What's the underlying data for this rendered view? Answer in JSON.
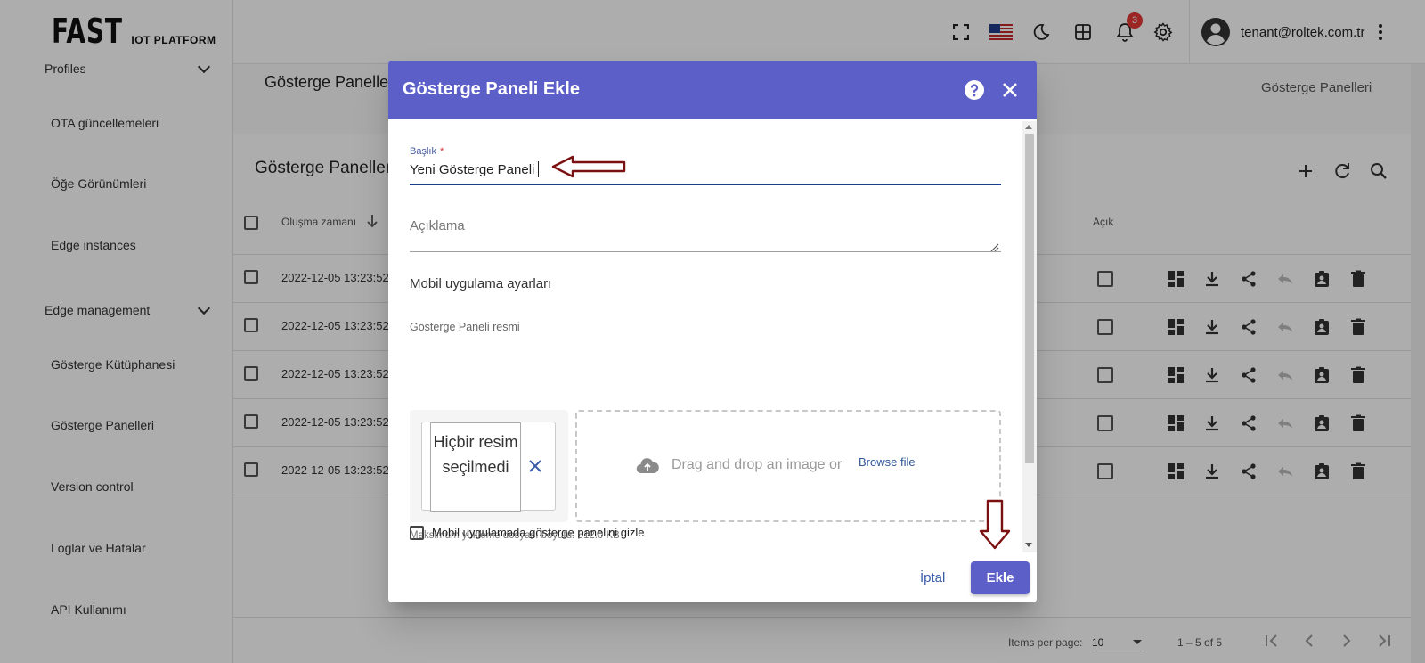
{
  "app": {
    "logo_main": "FAST",
    "logo_sub": "IOT PLATFORM",
    "user_email": "tenant@roltek.com.tr",
    "notification_count": "3"
  },
  "sidebar": {
    "items": [
      {
        "label": "Profiles",
        "type": "group"
      },
      {
        "label": "OTA güncellemeleri"
      },
      {
        "label": "Öğe Görünümleri"
      },
      {
        "label": "Edge instances"
      },
      {
        "label": "Edge management",
        "type": "group"
      },
      {
        "label": "Gösterge Kütüphanesi"
      },
      {
        "label": "Gösterge Panelleri"
      },
      {
        "label": "Version control"
      },
      {
        "label": "Loglar ve Hatalar"
      },
      {
        "label": "API Kullanımı"
      }
    ]
  },
  "page": {
    "breadcrumb_title": "Gösterge Panelleri",
    "breadcrumb_right": "Gösterge Panelleri",
    "card_title": "Gösterge Panelleri",
    "col_created": "Oluşma zamanı",
    "col_public": "Açık",
    "rows": [
      {
        "created": "2022-12-05 13:23:52"
      },
      {
        "created": "2022-12-05 13:23:52"
      },
      {
        "created": "2022-12-05 13:23:52"
      },
      {
        "created": "2022-12-05 13:23:52"
      },
      {
        "created": "2022-12-05 13:23:52"
      }
    ],
    "footer": {
      "items_per_page_label": "Items per page:",
      "items_per_page_value": "10",
      "range": "1 – 5 of 5"
    }
  },
  "dialog": {
    "title": "Gösterge Paneli Ekle",
    "title_label": "Başlık",
    "required_mark": "*",
    "title_value": "Yeni Gösterge Paneli",
    "description_placeholder": "Açıklama",
    "mobile_settings": "Mobil uygulama ayarları",
    "image_label": "Gösterge Paneli resmi",
    "no_image": "Hiçbir resim seçilmedi",
    "drag_drop_text": "Drag and drop an image or",
    "browse_file": "Browse file",
    "max_size": "Maksimum yükleme dosyası boyutu: 512.0 KB",
    "hide_mobile_label": "Mobil uygulamada gösterge panelini gizle",
    "cancel_label": "İptal",
    "add_label": "Ekle"
  },
  "colors": {
    "dialog_header": "#5c5fc8",
    "annotation_arrow": "#7b1010",
    "underline": "#1e3a8a"
  }
}
